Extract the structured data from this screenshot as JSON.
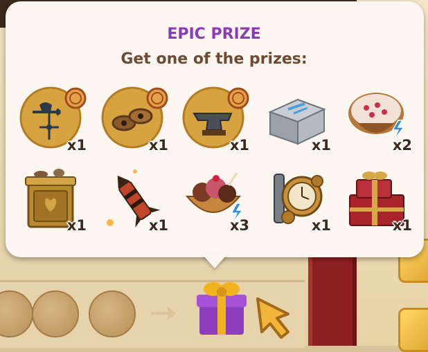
{
  "popup": {
    "title": "EPIC PRIZE",
    "subtitle": "Get one of the prizes:"
  },
  "prizes": [
    {
      "item": "weathervane-booster",
      "icon": "weathervane-icon",
      "qty": "x1"
    },
    {
      "item": "gears-booster",
      "icon": "gears-icon",
      "qty": "x1"
    },
    {
      "item": "anvil-booster",
      "icon": "anvil-icon",
      "qty": "x1"
    },
    {
      "item": "metal-chest",
      "icon": "chest-icon",
      "qty": "x1"
    },
    {
      "item": "berry-porridge",
      "icon": "porridge-bowl-icon",
      "qty": "x2"
    },
    {
      "item": "gold-cabinet",
      "icon": "cabinet-icon",
      "qty": "x1"
    },
    {
      "item": "firework-rocket",
      "icon": "rocket-icon",
      "qty": "x1"
    },
    {
      "item": "ice-cream-basket",
      "icon": "ice-cream-icon",
      "qty": "x3"
    },
    {
      "item": "clockwork-device",
      "icon": "clockwork-icon",
      "qty": "x1"
    },
    {
      "item": "red-gift-boxes",
      "icon": "gift-boxes-icon",
      "qty": "x1"
    }
  ],
  "colors": {
    "title": "#8a3cb5",
    "subtitle": "#6b4b34",
    "tooltip_bg": "#fbf7f0",
    "gift_box": "#8e3fc0",
    "gift_ribbon": "#f2b321"
  }
}
